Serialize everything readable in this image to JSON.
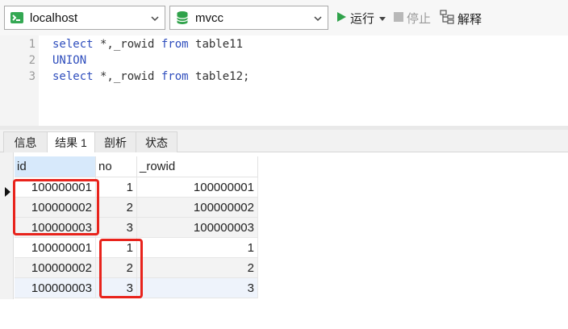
{
  "toolbar": {
    "connection": "localhost",
    "database": "mvcc",
    "run_label": "运行",
    "stop_label": "停止",
    "explain_label": "解释",
    "colors": {
      "run": "#2fa24a",
      "connection_icon": "#34a853",
      "database_icon": "#2fa24a",
      "disabled": "#9a9a9a"
    }
  },
  "editor": {
    "line_numbers": [
      "1",
      "2",
      "3"
    ],
    "lines": [
      {
        "kw1": "select",
        "t1": " *,_rowid ",
        "kw2": "from",
        "t2": " table11"
      },
      {
        "kw1": "UNION"
      },
      {
        "kw1": "select",
        "t1": " *,_rowid ",
        "kw2": "from",
        "t2": " table12;"
      }
    ]
  },
  "tabs": [
    "信息",
    "结果 1",
    "剖析",
    "状态"
  ],
  "active_tab": "结果 1",
  "grid": {
    "columns": [
      "id",
      "no",
      "_rowid"
    ],
    "rows": [
      [
        "100000001",
        "1",
        "100000001"
      ],
      [
        "100000002",
        "2",
        "100000002"
      ],
      [
        "100000003",
        "3",
        "100000003"
      ],
      [
        "100000001",
        "1",
        "1"
      ],
      [
        "100000002",
        "2",
        "2"
      ],
      [
        "100000003",
        "3",
        "3"
      ]
    ],
    "highlight_color": "#e8231c"
  }
}
